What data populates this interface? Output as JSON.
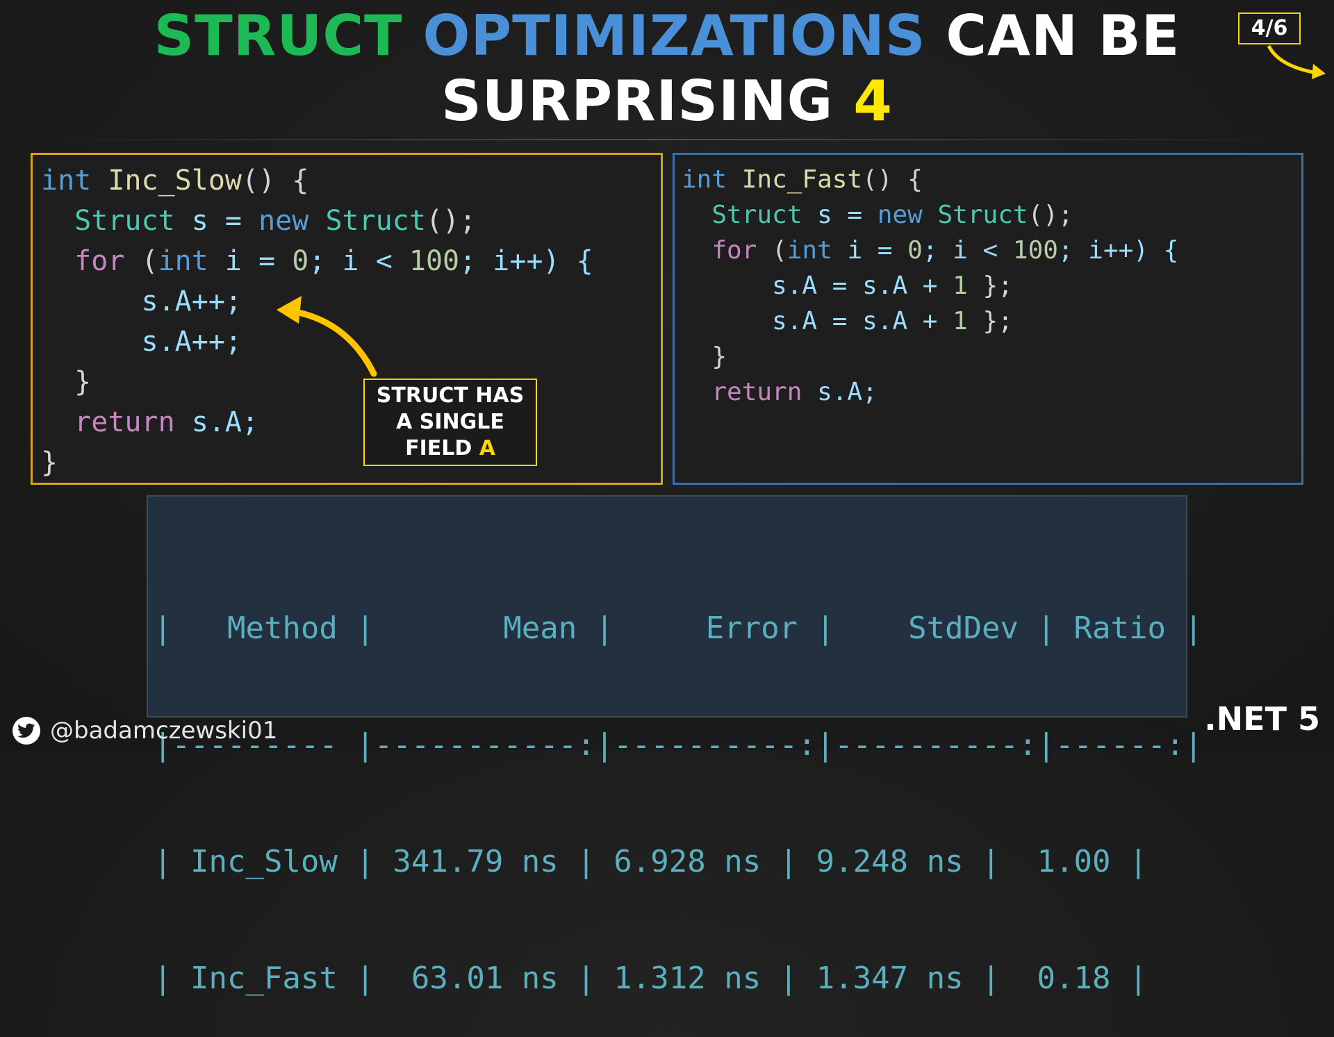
{
  "title": {
    "line1": {
      "word1": "STRUCT",
      "word2": "OPTIMIZATIONS",
      "word3": "CAN BE"
    },
    "line2": {
      "word1": "SURPRISING",
      "number": "4"
    }
  },
  "page_indicator": "4/6",
  "slow_code": {
    "lines": [
      [
        {
          "t": "int",
          "c": "kw"
        },
        {
          "t": " ",
          "c": "pl"
        },
        {
          "t": "Inc_Slow",
          "c": "fn"
        },
        {
          "t": "() {",
          "c": "pl"
        }
      ],
      [
        {
          "t": "  ",
          "c": "pl"
        },
        {
          "t": "Struct",
          "c": "ty"
        },
        {
          "t": " s = ",
          "c": "id"
        },
        {
          "t": "new",
          "c": "kw"
        },
        {
          "t": " ",
          "c": "pl"
        },
        {
          "t": "Struct",
          "c": "ty"
        },
        {
          "t": "();",
          "c": "pl"
        }
      ],
      [
        {
          "t": "  ",
          "c": "pl"
        },
        {
          "t": "for",
          "c": "ct"
        },
        {
          "t": " (",
          "c": "pl"
        },
        {
          "t": "int",
          "c": "kw"
        },
        {
          "t": " i = ",
          "c": "id"
        },
        {
          "t": "0",
          "c": "num"
        },
        {
          "t": "; i < ",
          "c": "id"
        },
        {
          "t": "100",
          "c": "num"
        },
        {
          "t": "; i++) {",
          "c": "id"
        }
      ],
      [
        {
          "t": "      ",
          "c": "pl"
        },
        {
          "t": "s.A++;",
          "c": "id"
        }
      ],
      [
        {
          "t": "      ",
          "c": "pl"
        },
        {
          "t": "s.A++;",
          "c": "id"
        }
      ],
      [
        {
          "t": "  }",
          "c": "pl"
        }
      ],
      [
        {
          "t": "  ",
          "c": "pl"
        },
        {
          "t": "return",
          "c": "ct"
        },
        {
          "t": " s.A;",
          "c": "id"
        }
      ],
      [
        {
          "t": "}",
          "c": "pl"
        }
      ]
    ]
  },
  "fast_code": {
    "lines": [
      [
        {
          "t": "int",
          "c": "kw"
        },
        {
          "t": " ",
          "c": "pl"
        },
        {
          "t": "Inc_Fast",
          "c": "fn"
        },
        {
          "t": "() {",
          "c": "pl"
        }
      ],
      [
        {
          "t": "  ",
          "c": "pl"
        },
        {
          "t": "Struct",
          "c": "ty"
        },
        {
          "t": " s = ",
          "c": "id"
        },
        {
          "t": "new",
          "c": "kw"
        },
        {
          "t": " ",
          "c": "pl"
        },
        {
          "t": "Struct",
          "c": "ty"
        },
        {
          "t": "();",
          "c": "pl"
        }
      ],
      [
        {
          "t": "  ",
          "c": "pl"
        },
        {
          "t": "for",
          "c": "ct"
        },
        {
          "t": " (",
          "c": "pl"
        },
        {
          "t": "int",
          "c": "kw"
        },
        {
          "t": " i = ",
          "c": "id"
        },
        {
          "t": "0",
          "c": "num"
        },
        {
          "t": "; i < ",
          "c": "id"
        },
        {
          "t": "100",
          "c": "num"
        },
        {
          "t": "; i++) {",
          "c": "id"
        }
      ],
      [
        {
          "t": "      ",
          "c": "pl"
        },
        {
          "t": "s.A = s.A + ",
          "c": "id"
        },
        {
          "t": "1",
          "c": "num"
        },
        {
          "t": " };",
          "c": "pl"
        }
      ],
      [
        {
          "t": "      ",
          "c": "pl"
        },
        {
          "t": "s.A = s.A + ",
          "c": "id"
        },
        {
          "t": "1",
          "c": "num"
        },
        {
          "t": " };",
          "c": "pl"
        }
      ],
      [
        {
          "t": "  }",
          "c": "pl"
        }
      ],
      [
        {
          "t": "  ",
          "c": "pl"
        },
        {
          "t": "return",
          "c": "ct"
        },
        {
          "t": " s.A;",
          "c": "id"
        }
      ]
    ]
  },
  "callout": {
    "line1": "STRUCT HAS",
    "line2": "A SINGLE",
    "line3_prefix": "FIELD ",
    "line3_highlight": "A"
  },
  "results": {
    "header": "|   Method |       Mean |     Error |    StdDev | Ratio |",
    "separator": "|--------- |-----------:|----------:|----------:|------:|",
    "rows": [
      "| Inc_Slow | 341.79 ns | 6.928 ns | 9.248 ns |  1.00 |",
      "| Inc_Fast |  63.01 ns | 1.312 ns | 1.347 ns |  0.18 |"
    ]
  },
  "footer": {
    "handle": "@badamczewski01",
    "platform": ".NET 5"
  },
  "colors": {
    "green": "#1db954",
    "blue": "#4a90d9",
    "yellow": "#ffe800",
    "slow_border": "#d9a21b",
    "fast_border": "#3b6ea5"
  }
}
